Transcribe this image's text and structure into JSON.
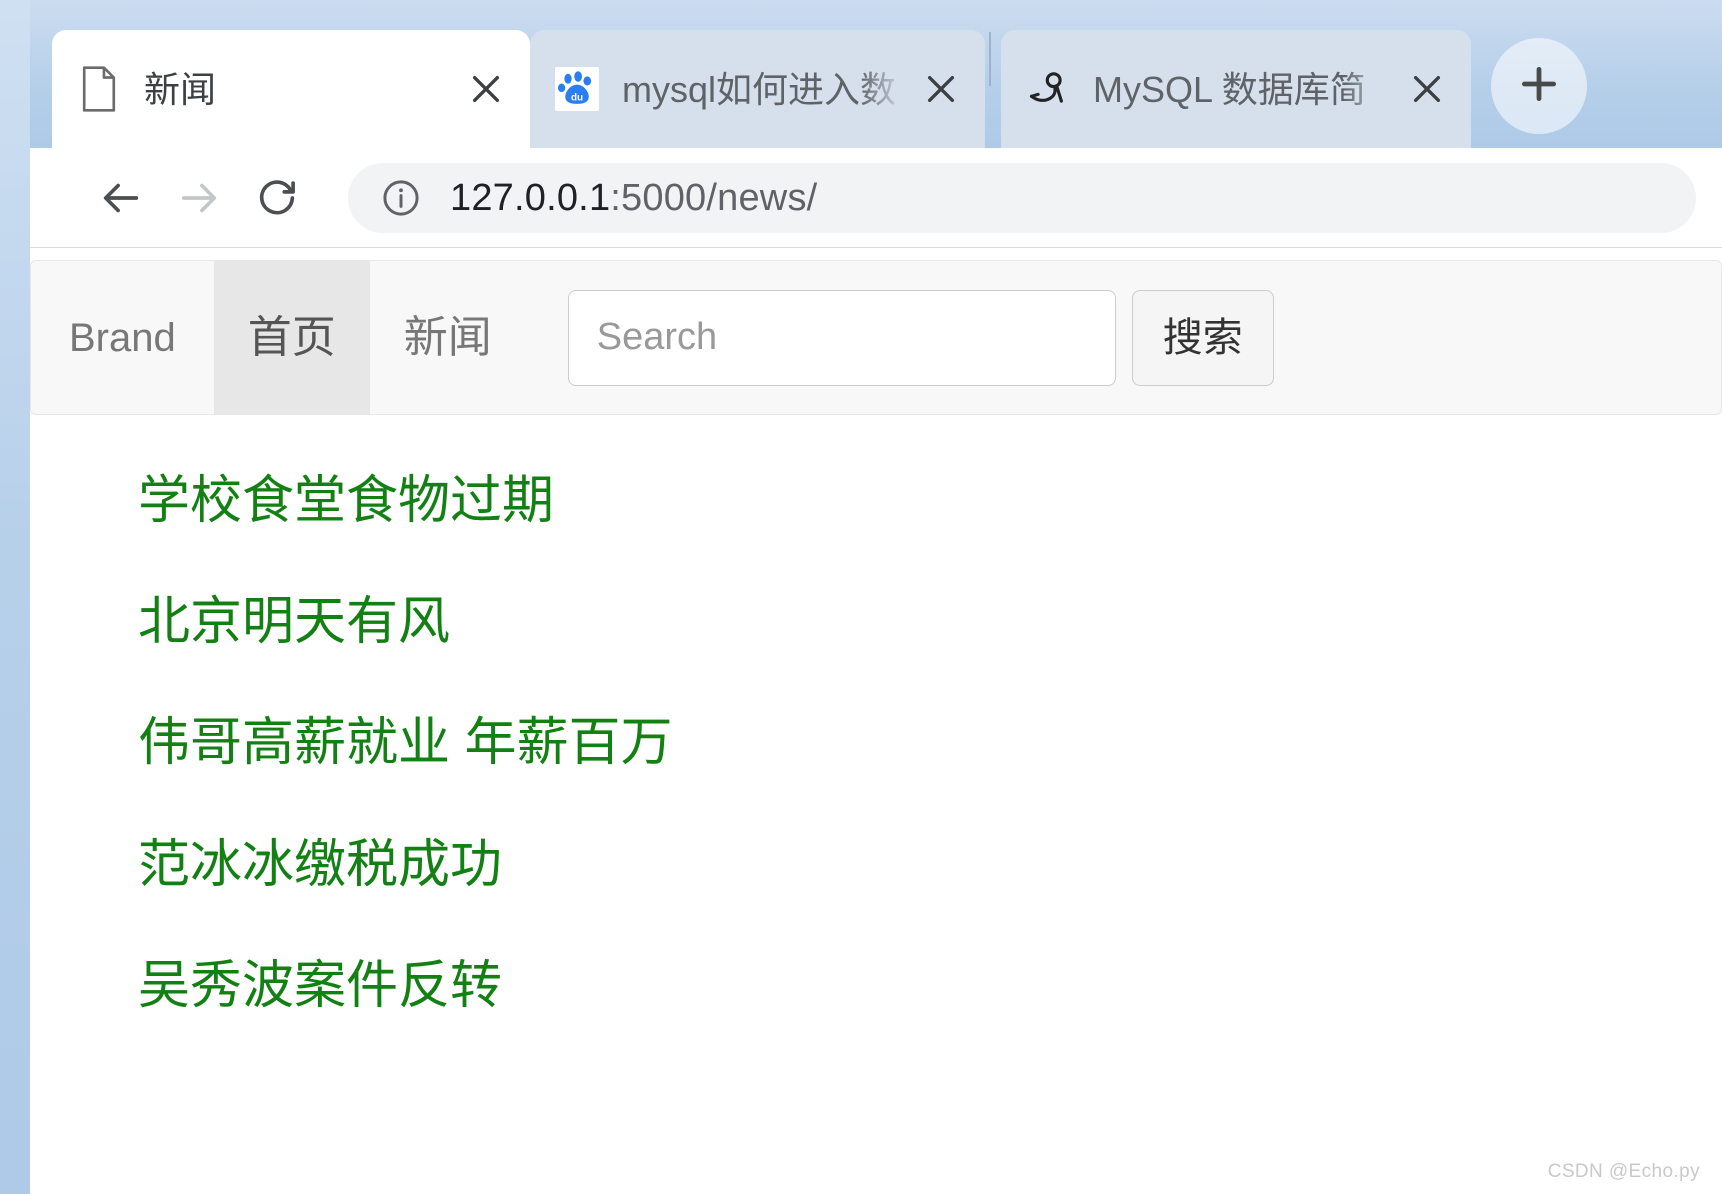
{
  "browser": {
    "tabs": [
      {
        "title": "新闻",
        "favicon": "document-icon",
        "active": true,
        "close_label": "×"
      },
      {
        "title": "mysql如何进入数",
        "favicon": "baidu-icon",
        "active": false,
        "close_label": "×"
      },
      {
        "title": "MySQL 数据库简",
        "favicon": "mysql-dolphin-icon",
        "active": false,
        "close_label": "×"
      }
    ],
    "new_tab_label": "+",
    "toolbar": {
      "back_icon": "back-arrow-icon",
      "forward_icon": "forward-arrow-icon",
      "reload_icon": "reload-icon",
      "site_info_icon": "info-circle-icon",
      "url_host": "127.0.0.1",
      "url_rest": ":5000/news/",
      "url_full": "127.0.0.1:5000/news/"
    }
  },
  "navbar": {
    "brand": "Brand",
    "items": [
      {
        "label": "首页",
        "active": true
      },
      {
        "label": "新闻",
        "active": false
      }
    ],
    "search": {
      "placeholder": "Search",
      "value": "",
      "button_label": "搜索"
    }
  },
  "main": {
    "news": [
      "学校食堂食物过期",
      "北京明天有风",
      "伟哥高薪就业 年薪百万",
      "范冰冰缴税成功",
      "吴秀波案件反转"
    ]
  },
  "watermark": "CSDN @Echo.py",
  "colors": {
    "link_green": "#128012",
    "tabstrip_blue": "#b5cfe9",
    "navbar_bg": "#f8f8f8",
    "nav_active_bg": "#e7e7e7"
  }
}
